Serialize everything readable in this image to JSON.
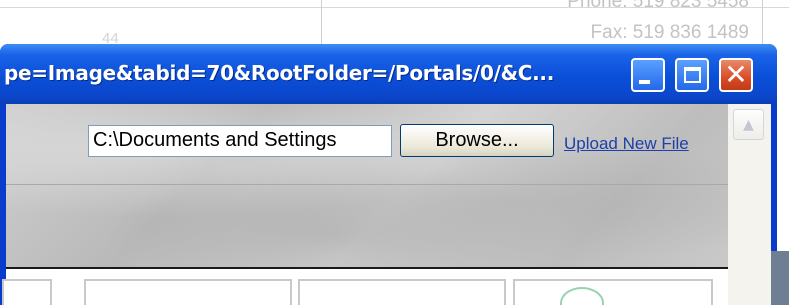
{
  "background": {
    "phone": "Phone: 519 823 5458",
    "fax": "Fax: 519 836 1489",
    "fragment_number": "44"
  },
  "window": {
    "title": "pe=Image&tabid=70&RootFolder=/Portals/0/&C...",
    "minimize_icon": "minimize-icon",
    "maximize_icon": "maximize-icon",
    "close_icon": "close-icon"
  },
  "upload": {
    "file_path_value": "C:\\Documents and Settings",
    "browse_label": "Browse...",
    "upload_link_label": "Upload New File"
  },
  "colors": {
    "titlebar": "#0a4fd8",
    "close_button": "#d94c26",
    "link": "#1f3fa8"
  }
}
